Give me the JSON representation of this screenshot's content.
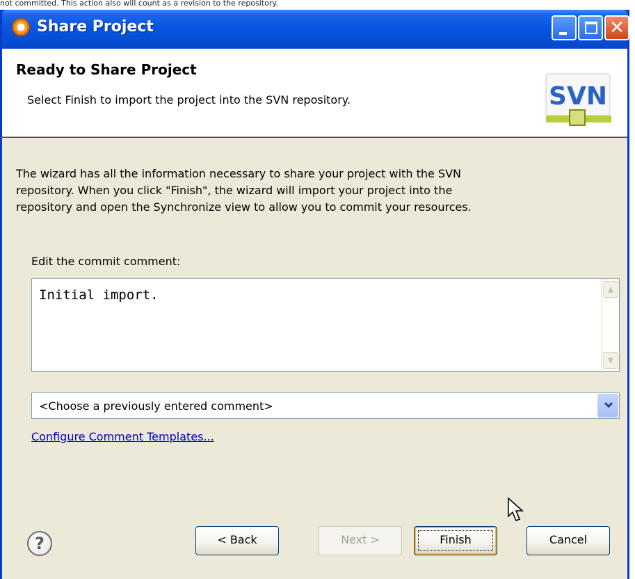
{
  "top_strip_text": "not committed. This action also will count as a revision to the repository.",
  "window": {
    "title": "Share Project",
    "controls": {
      "minimize_icon": "minimize-icon",
      "maximize_icon": "maximize-icon",
      "close_icon": "close-icon"
    }
  },
  "banner": {
    "title": "Ready to Share Project",
    "description": "Select Finish to import the project into the SVN repository.",
    "logo_text": "SVN"
  },
  "content": {
    "intro": "The wizard has all the information necessary to share your project with the SVN repository. When you click \"Finish\", the wizard will import your project into the repository and open the Synchronize view to allow you to commit your resources.",
    "comment_label": "Edit the commit comment:",
    "comment_value": "Initial import.",
    "previous_comment_placeholder": "<Choose a previously entered comment>",
    "configure_link": "Configure Comment Templates..."
  },
  "buttons": {
    "back": "< Back",
    "next": "Next >",
    "finish": "Finish",
    "cancel": "Cancel",
    "help_glyph": "?"
  },
  "colors": {
    "titlebar": "#0a57e2",
    "dialog_body": "#ece9d8",
    "link": "#0000cc",
    "finish_focus": "#f2b54a"
  }
}
